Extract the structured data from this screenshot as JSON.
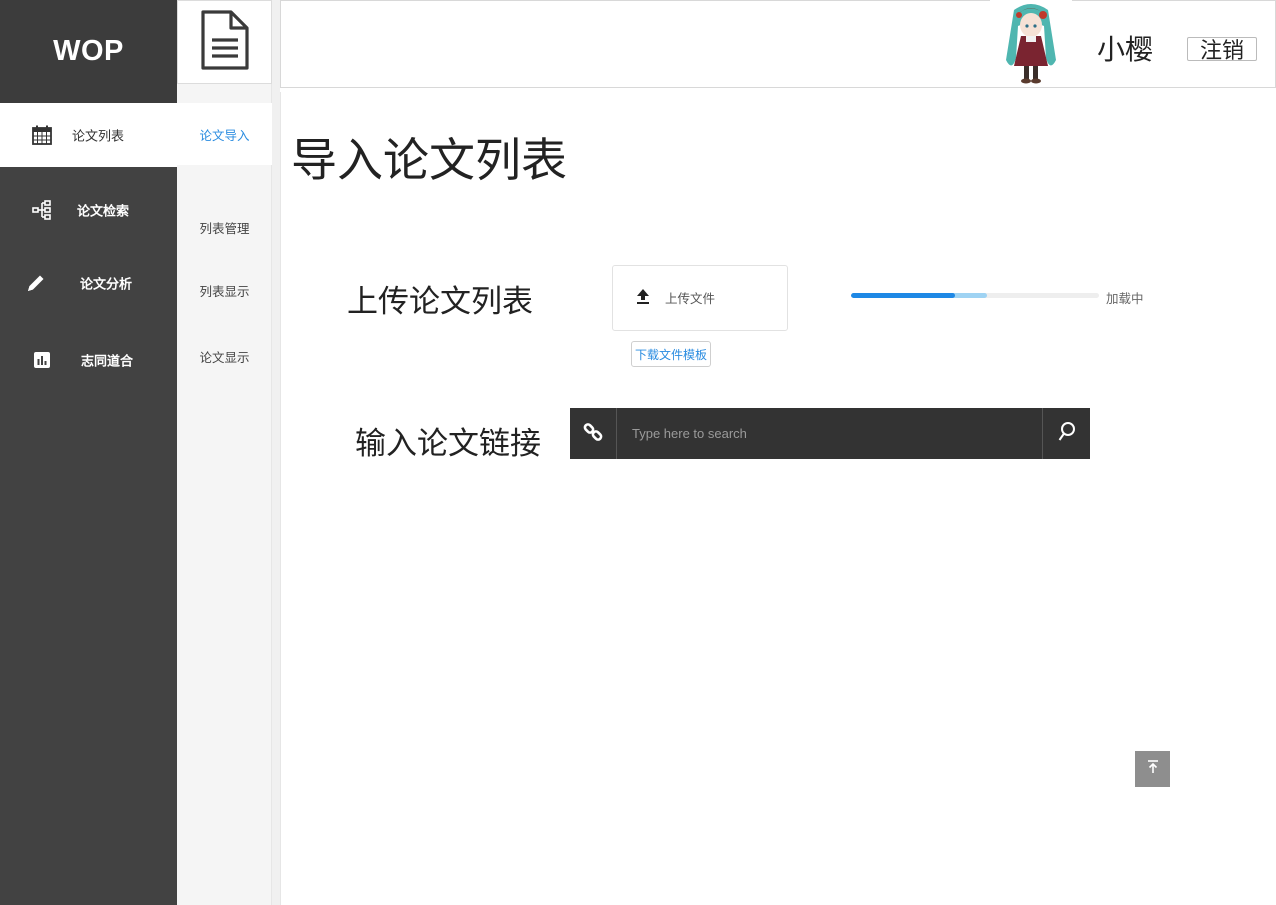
{
  "brand": {
    "logo_text": "WOP"
  },
  "sidebar": {
    "items": [
      {
        "label": "论文列表",
        "icon": "calendar-icon",
        "active": true
      },
      {
        "label": "论文检索",
        "icon": "tree-icon",
        "active": false
      },
      {
        "label": "论文分析",
        "icon": "pencil-icon",
        "active": false
      },
      {
        "label": "志同道合",
        "icon": "bar-chart-icon",
        "active": false
      }
    ]
  },
  "subnav": {
    "icon": "document-icon",
    "items": [
      {
        "label": "论文导入",
        "active": true
      },
      {
        "label": "列表管理",
        "active": false
      },
      {
        "label": "列表显示",
        "active": false
      },
      {
        "label": "论文显示",
        "active": false
      }
    ]
  },
  "header": {
    "username": "小樱",
    "logout_label": "注销"
  },
  "main": {
    "title": "导入论文列表",
    "upload": {
      "label": "上传论文列表",
      "button_label": "上传文件",
      "template_link": "下载文件模板",
      "progress_value": 0.42,
      "progress_buffer": 0.55,
      "progress_label": "加载中"
    },
    "link_input": {
      "label": "输入论文链接",
      "placeholder": "Type here to search"
    }
  },
  "colors": {
    "sidebar_bg": "#424242",
    "accent": "#2a8ce0",
    "progress": "#1e88e5",
    "search_bg": "#333333"
  }
}
